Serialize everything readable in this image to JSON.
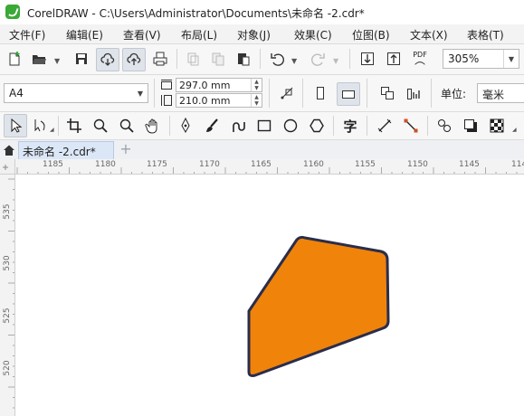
{
  "window": {
    "title": "CorelDRAW - C:\\Users\\Administrator\\Documents\\未命名 -2.cdr*"
  },
  "menu": [
    "文件(F)",
    "编辑(E)",
    "查看(V)",
    "布局(L)",
    "对象(J)",
    "效果(C)",
    "位图(B)",
    "文本(X)",
    "表格(T)"
  ],
  "standard_toolbar": {
    "zoom": "305%",
    "pdf_label": "PDF"
  },
  "property_bar": {
    "page_size": "A4",
    "width": "297.0 mm",
    "height": "210.0 mm",
    "units_label": "单位:",
    "units_value": "毫米"
  },
  "toolbox": {
    "text_tool_glyph": "字"
  },
  "document_tab": {
    "name": "未命名 -2.cdr*",
    "add": "+"
  },
  "ruler_h": [
    "1185",
    "1180",
    "1175",
    "1170",
    "1165",
    "1160",
    "1155",
    "1150",
    "1145",
    "114"
  ],
  "ruler_v": [
    "535",
    "530",
    "525",
    "520"
  ],
  "shape": {
    "fill": "#f0830a",
    "stroke": "#2a2d4a"
  },
  "colors": {
    "accent": "#3aa935",
    "selection": "#dbe7f7"
  }
}
